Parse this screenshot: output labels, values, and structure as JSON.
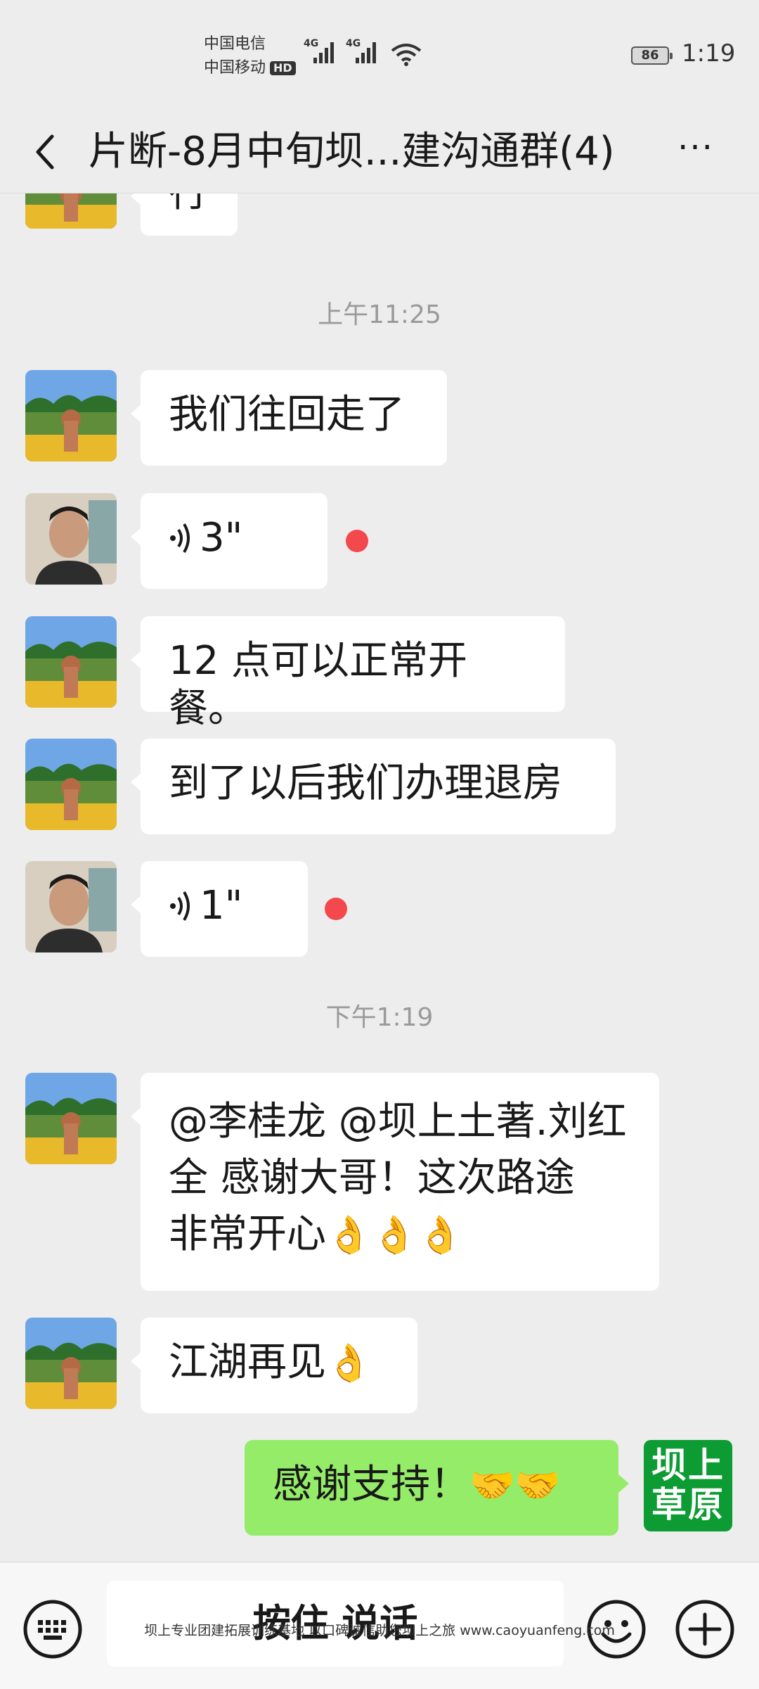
{
  "status_bar": {
    "carrier_1": "中国电信",
    "carrier_2": "中国移动",
    "hd_badge": "HD",
    "network_1": "4G",
    "network_2": "4G",
    "battery": "86",
    "time": "1:19",
    "icons": [
      "signal-icon",
      "wifi-icon",
      "battery-icon"
    ]
  },
  "header": {
    "title": "片断-8月中旬坝...建沟通群(4)",
    "back_icon": "chevron-left-icon",
    "more_icon": "more-icon",
    "more_label": "···"
  },
  "messages": [
    {
      "type": "text",
      "side": "left",
      "sender_avatar": "landscape",
      "text": "行"
    },
    {
      "type": "timestamp",
      "text": "上午11:25"
    },
    {
      "type": "text",
      "side": "left",
      "sender_avatar": "landscape",
      "text": "我们往回走了"
    },
    {
      "type": "voice",
      "side": "left",
      "sender_avatar": "man",
      "duration": "3\"",
      "unread": true
    },
    {
      "type": "text",
      "side": "left",
      "sender_avatar": "landscape",
      "text": "12 点可以正常开餐。"
    },
    {
      "type": "text",
      "side": "left",
      "sender_avatar": "landscape",
      "text": "到了以后我们办理退房"
    },
    {
      "type": "voice",
      "side": "left",
      "sender_avatar": "man",
      "duration": "1\"",
      "unread": true
    },
    {
      "type": "timestamp",
      "text": "下午1:19"
    },
    {
      "type": "text",
      "side": "left",
      "sender_avatar": "landscape",
      "text_lines": [
        "@李桂龙 @坝上土著.刘红",
        "全  感谢大哥！这次路途",
        "非常开心"
      ],
      "emoji": "👌👌👌"
    },
    {
      "type": "text",
      "side": "left",
      "sender_avatar": "landscape",
      "text": "江湖再见",
      "emoji": "👌"
    },
    {
      "type": "text",
      "side": "right",
      "sender_avatar": "brand",
      "text": "感谢支持！",
      "emoji": "🤝🤝"
    }
  ],
  "brand_avatar": {
    "line1": "坝上",
    "line2": "草原",
    "color": "#0d9b33"
  },
  "input_bar": {
    "hold_to_talk": "按住 说话",
    "icons": [
      "keyboard-icon",
      "emoji-icon",
      "plus-icon"
    ]
  },
  "watermark": "坝上专业团建拓展训练基地 以口碑诚信助您坝上之旅 www.caoyuanfeng.com",
  "colors": {
    "background": "#ededed",
    "bubble_left": "#ffffff",
    "bubble_right": "#95ec69",
    "unread_dot": "#f3484c",
    "brand": "#0d9b33"
  }
}
